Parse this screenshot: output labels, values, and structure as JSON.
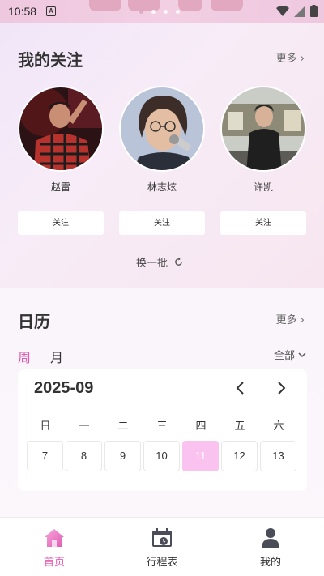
{
  "status_bar": {
    "time": "10:58",
    "app_glyph": "A"
  },
  "following": {
    "title": "我的关注",
    "more": "更多",
    "artists": [
      {
        "name": "赵雷",
        "follow_label": "关注"
      },
      {
        "name": "林志炫",
        "follow_label": "关注"
      },
      {
        "name": "许凯",
        "follow_label": "关注"
      }
    ],
    "refresh_label": "换一批"
  },
  "calendar": {
    "title": "日历",
    "more": "更多",
    "tabs": [
      {
        "label": "周",
        "active": true
      },
      {
        "label": "月",
        "active": false
      }
    ],
    "filter_label": "全部",
    "month": "2025-09",
    "weekdays": [
      "日",
      "一",
      "二",
      "三",
      "四",
      "五",
      "六"
    ],
    "dates": [
      "7",
      "8",
      "9",
      "10",
      "11",
      "12",
      "13"
    ],
    "selected_date": "11",
    "accent_color": "#e25ab0",
    "selected_color": "#f9c2ef"
  },
  "bottom_nav": {
    "items": [
      {
        "label": "首页",
        "icon": "home-icon",
        "active": true
      },
      {
        "label": "行程表",
        "icon": "calendar-schedule-icon",
        "active": false
      },
      {
        "label": "我的",
        "icon": "user-icon",
        "active": false
      }
    ]
  }
}
